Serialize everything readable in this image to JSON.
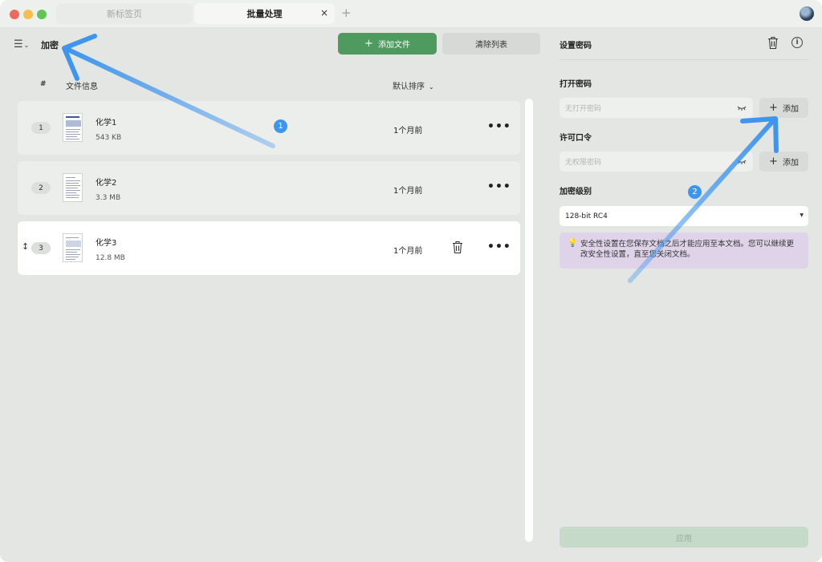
{
  "titlebar": {
    "tabs": [
      {
        "label": "新标签页",
        "active": false
      },
      {
        "label": "批量处理",
        "active": true
      }
    ],
    "close_glyph": "×",
    "new_tab_glyph": "+"
  },
  "toolbar": {
    "menu_glyph": "☰",
    "chevron": "⌄",
    "title": "加密",
    "add_file_label": "添加文件",
    "clear_list_label": "清除列表"
  },
  "list": {
    "col_index": "#",
    "col_info": "文件信息",
    "sort_label": "默认排序",
    "files": [
      {
        "index": "1",
        "name": "化学1",
        "size": "543 KB",
        "date": "1个月前"
      },
      {
        "index": "2",
        "name": "化学2",
        "size": "3.3 MB",
        "date": "1个月前"
      },
      {
        "index": "3",
        "name": "化学3",
        "size": "12.8 MB",
        "date": "1个月前"
      }
    ],
    "drag_glyph": "↕",
    "more_glyph": "•••"
  },
  "annotations": {
    "badge1": "1",
    "badge2": "2",
    "arrow_color": "#3d95ef"
  },
  "settings": {
    "title": "设置密码",
    "info_glyph": "i",
    "open_password": {
      "label": "打开密码",
      "placeholder": "无打开密码",
      "add_label": "添加"
    },
    "permission_password": {
      "label": "许可口令",
      "placeholder": "无权限密码",
      "add_label": "添加"
    },
    "encryption_level": {
      "label": "加密级别",
      "selected": "128-bit RC4"
    },
    "note": "安全性设置在您保存文档之后才能应用至本文档。您可以继续更改安全性设置，直至您关闭文档。",
    "apply_label": "应用"
  },
  "colors": {
    "primary_green": "#4f9a5f",
    "apply_disabled": "#c6dac9",
    "note_bg": "#dfd3ea",
    "annotation_blue": "#3d95ef"
  }
}
